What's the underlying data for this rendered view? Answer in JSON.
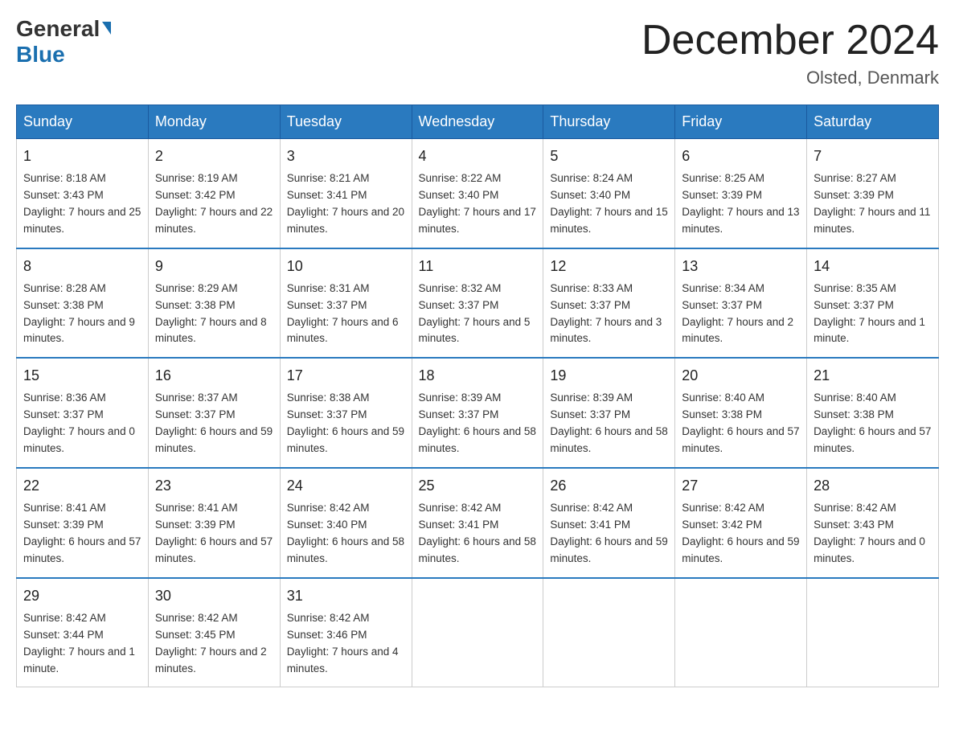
{
  "logo": {
    "general": "General",
    "blue": "Blue"
  },
  "title": "December 2024",
  "location": "Olsted, Denmark",
  "weekdays": [
    "Sunday",
    "Monday",
    "Tuesday",
    "Wednesday",
    "Thursday",
    "Friday",
    "Saturday"
  ],
  "weeks": [
    [
      {
        "day": "1",
        "sunrise": "8:18 AM",
        "sunset": "3:43 PM",
        "daylight": "7 hours and 25 minutes."
      },
      {
        "day": "2",
        "sunrise": "8:19 AM",
        "sunset": "3:42 PM",
        "daylight": "7 hours and 22 minutes."
      },
      {
        "day": "3",
        "sunrise": "8:21 AM",
        "sunset": "3:41 PM",
        "daylight": "7 hours and 20 minutes."
      },
      {
        "day": "4",
        "sunrise": "8:22 AM",
        "sunset": "3:40 PM",
        "daylight": "7 hours and 17 minutes."
      },
      {
        "day": "5",
        "sunrise": "8:24 AM",
        "sunset": "3:40 PM",
        "daylight": "7 hours and 15 minutes."
      },
      {
        "day": "6",
        "sunrise": "8:25 AM",
        "sunset": "3:39 PM",
        "daylight": "7 hours and 13 minutes."
      },
      {
        "day": "7",
        "sunrise": "8:27 AM",
        "sunset": "3:39 PM",
        "daylight": "7 hours and 11 minutes."
      }
    ],
    [
      {
        "day": "8",
        "sunrise": "8:28 AM",
        "sunset": "3:38 PM",
        "daylight": "7 hours and 9 minutes."
      },
      {
        "day": "9",
        "sunrise": "8:29 AM",
        "sunset": "3:38 PM",
        "daylight": "7 hours and 8 minutes."
      },
      {
        "day": "10",
        "sunrise": "8:31 AM",
        "sunset": "3:37 PM",
        "daylight": "7 hours and 6 minutes."
      },
      {
        "day": "11",
        "sunrise": "8:32 AM",
        "sunset": "3:37 PM",
        "daylight": "7 hours and 5 minutes."
      },
      {
        "day": "12",
        "sunrise": "8:33 AM",
        "sunset": "3:37 PM",
        "daylight": "7 hours and 3 minutes."
      },
      {
        "day": "13",
        "sunrise": "8:34 AM",
        "sunset": "3:37 PM",
        "daylight": "7 hours and 2 minutes."
      },
      {
        "day": "14",
        "sunrise": "8:35 AM",
        "sunset": "3:37 PM",
        "daylight": "7 hours and 1 minute."
      }
    ],
    [
      {
        "day": "15",
        "sunrise": "8:36 AM",
        "sunset": "3:37 PM",
        "daylight": "7 hours and 0 minutes."
      },
      {
        "day": "16",
        "sunrise": "8:37 AM",
        "sunset": "3:37 PM",
        "daylight": "6 hours and 59 minutes."
      },
      {
        "day": "17",
        "sunrise": "8:38 AM",
        "sunset": "3:37 PM",
        "daylight": "6 hours and 59 minutes."
      },
      {
        "day": "18",
        "sunrise": "8:39 AM",
        "sunset": "3:37 PM",
        "daylight": "6 hours and 58 minutes."
      },
      {
        "day": "19",
        "sunrise": "8:39 AM",
        "sunset": "3:37 PM",
        "daylight": "6 hours and 58 minutes."
      },
      {
        "day": "20",
        "sunrise": "8:40 AM",
        "sunset": "3:38 PM",
        "daylight": "6 hours and 57 minutes."
      },
      {
        "day": "21",
        "sunrise": "8:40 AM",
        "sunset": "3:38 PM",
        "daylight": "6 hours and 57 minutes."
      }
    ],
    [
      {
        "day": "22",
        "sunrise": "8:41 AM",
        "sunset": "3:39 PM",
        "daylight": "6 hours and 57 minutes."
      },
      {
        "day": "23",
        "sunrise": "8:41 AM",
        "sunset": "3:39 PM",
        "daylight": "6 hours and 57 minutes."
      },
      {
        "day": "24",
        "sunrise": "8:42 AM",
        "sunset": "3:40 PM",
        "daylight": "6 hours and 58 minutes."
      },
      {
        "day": "25",
        "sunrise": "8:42 AM",
        "sunset": "3:41 PM",
        "daylight": "6 hours and 58 minutes."
      },
      {
        "day": "26",
        "sunrise": "8:42 AM",
        "sunset": "3:41 PM",
        "daylight": "6 hours and 59 minutes."
      },
      {
        "day": "27",
        "sunrise": "8:42 AM",
        "sunset": "3:42 PM",
        "daylight": "6 hours and 59 minutes."
      },
      {
        "day": "28",
        "sunrise": "8:42 AM",
        "sunset": "3:43 PM",
        "daylight": "7 hours and 0 minutes."
      }
    ],
    [
      {
        "day": "29",
        "sunrise": "8:42 AM",
        "sunset": "3:44 PM",
        "daylight": "7 hours and 1 minute."
      },
      {
        "day": "30",
        "sunrise": "8:42 AM",
        "sunset": "3:45 PM",
        "daylight": "7 hours and 2 minutes."
      },
      {
        "day": "31",
        "sunrise": "8:42 AM",
        "sunset": "3:46 PM",
        "daylight": "7 hours and 4 minutes."
      },
      null,
      null,
      null,
      null
    ]
  ],
  "labels": {
    "sunrise": "Sunrise:",
    "sunset": "Sunset:",
    "daylight": "Daylight:"
  }
}
